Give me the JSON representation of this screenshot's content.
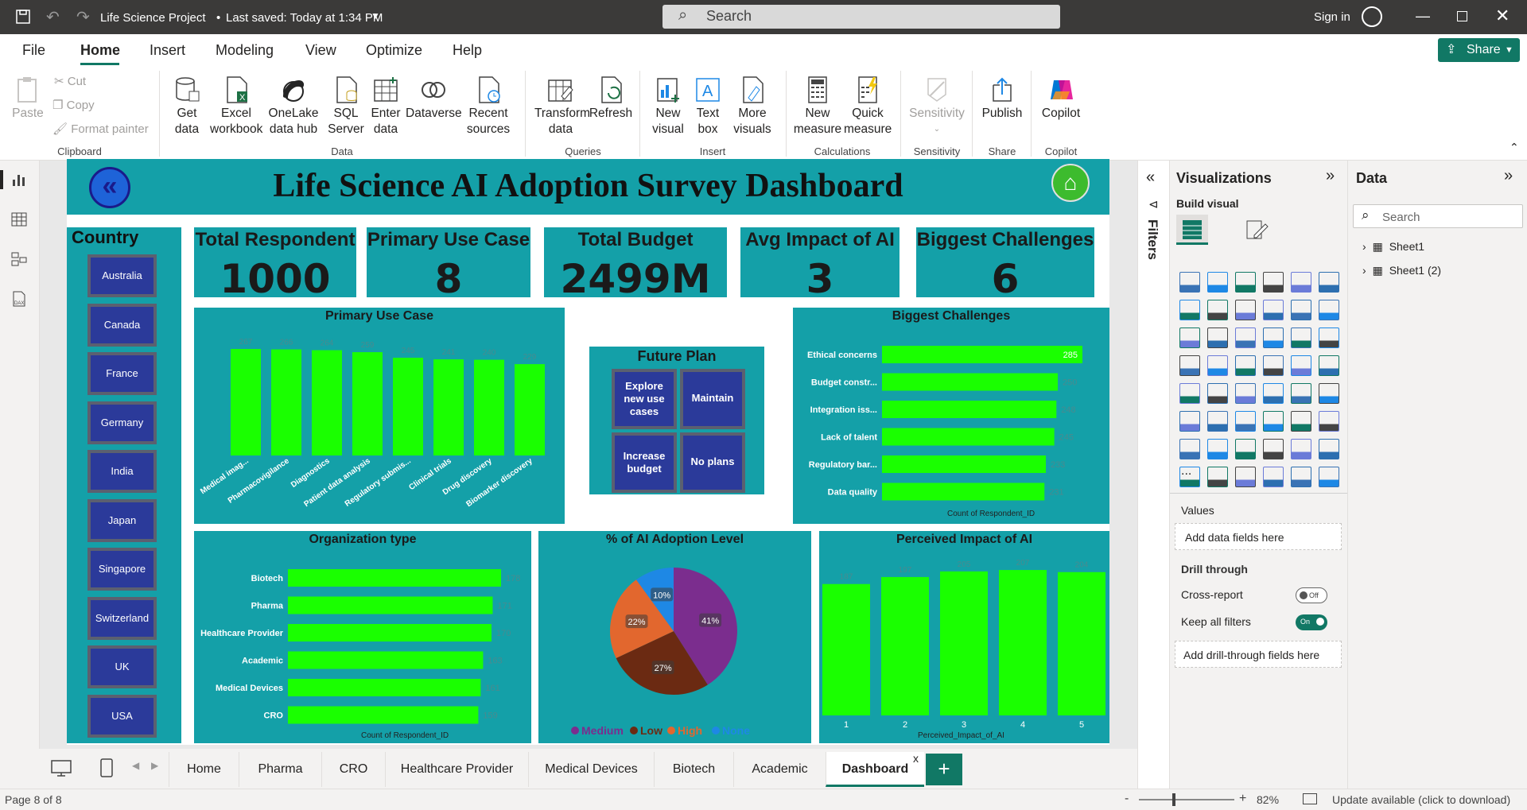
{
  "app": {
    "title": "Life Science Project",
    "saved": "Last saved: Today at 1:34 PM",
    "search": "Search",
    "signin": "Sign in"
  },
  "menu": {
    "file": "File",
    "home": "Home",
    "insert": "Insert",
    "modeling": "Modeling",
    "view": "View",
    "optimize": "Optimize",
    "help": "Help",
    "share": "Share"
  },
  "ribbon": {
    "paste": "Paste",
    "cut": "Cut",
    "copy": "Copy",
    "format_painter": "Format painter",
    "clipboard": "Clipboard",
    "get_data": "Get data",
    "excel": "Excel workbook",
    "onelake": "OneLake data hub",
    "sql": "SQL Server",
    "enter": "Enter data",
    "dataverse": "Dataverse",
    "recent": "Recent sources",
    "data": "Data",
    "transform": "Transform data",
    "refresh": "Refresh",
    "queries": "Queries",
    "new_visual": "New visual",
    "text_box": "Text box",
    "more_visuals": "More visuals",
    "insert": "Insert",
    "new_measure": "New measure",
    "quick_measure": "Quick measure",
    "calculations": "Calculations",
    "sensitivity": "Sensitivity",
    "sensitivity_group": "Sensitivity",
    "publish": "Publish",
    "share_group": "Share",
    "copilot": "Copilot",
    "copilot_group": "Copilot"
  },
  "dashboard": {
    "title": "Life Science AI Adoption Survey Dashboard",
    "country_label": "Country",
    "countries": [
      "Australia",
      "Canada",
      "France",
      "Germany",
      "India",
      "Japan",
      "Singapore",
      "Switzerland",
      "UK",
      "USA"
    ],
    "kpis": [
      {
        "label": "Total Respondent",
        "value": "1000"
      },
      {
        "label": "Primary Use Case",
        "value": "8"
      },
      {
        "label": "Total Budget",
        "value": "2499M"
      },
      {
        "label": "Avg Impact of AI",
        "value": "3"
      },
      {
        "label": "Biggest Challenges",
        "value": "6"
      }
    ],
    "future_plan": {
      "title": "Future Plan",
      "options": [
        "Explore new use cases",
        "Maintain",
        "Increase budget",
        "No plans"
      ]
    }
  },
  "chart_data": [
    {
      "type": "bar",
      "title": "Primary Use Case",
      "categories": [
        "Medical imag...",
        "Pharmacovigilance",
        "Diagnostics",
        "Patient data analysis",
        "Regulatory submis...",
        "Clinical trials",
        "Drug discovery",
        "Biomarker discovery"
      ],
      "values": [
        267,
        266,
        264,
        259,
        245,
        241,
        240,
        229
      ]
    },
    {
      "type": "bar",
      "orientation": "horizontal",
      "title": "Biggest Challenges",
      "categories": [
        "Ethical concerns",
        "Budget constr...",
        "Integration iss...",
        "Lack of talent",
        "Regulatory bar...",
        "Data quality"
      ],
      "values": [
        285,
        250,
        248,
        245,
        233,
        231
      ],
      "xlabel": "Count of Respondent_ID"
    },
    {
      "type": "bar",
      "orientation": "horizontal",
      "title": "Organization type",
      "categories": [
        "Biotech",
        "Pharma",
        "Healthcare Provider",
        "Academic",
        "Medical Devices",
        "CRO"
      ],
      "values": [
        178,
        171,
        170,
        163,
        161,
        159
      ],
      "xlabel": "Count of Respondent_ID"
    },
    {
      "type": "pie",
      "title": "% of AI Adoption Level",
      "categories": [
        "Medium",
        "Low",
        "High",
        "None"
      ],
      "values": [
        41,
        27,
        22,
        10
      ],
      "labels": [
        "41%",
        "27%",
        "22%",
        "10%"
      ],
      "colors": [
        "#7b2d8e",
        "#6b2a12",
        "#e2672e",
        "#1e88e5"
      ]
    },
    {
      "type": "bar",
      "title": "Perceived Impact of AI",
      "categories": [
        "1",
        "2",
        "3",
        "4",
        "5"
      ],
      "values": [
        187,
        197,
        205,
        207,
        204
      ],
      "xlabel": "Perceived_Impact_of_AI"
    }
  ],
  "visualizations": {
    "title": "Visualizations",
    "build": "Build visual",
    "values": "Values",
    "add_fields": "Add data fields here",
    "drill": "Drill through",
    "cross": "Cross-report",
    "cross_state": "Off",
    "keep": "Keep all filters",
    "keep_state": "On",
    "add_drill": "Add drill-through fields here",
    "more": "..."
  },
  "filters": {
    "label": "Filters"
  },
  "data_pane": {
    "title": "Data",
    "search": "Search",
    "tables": [
      "Sheet1",
      "Sheet1 (2)"
    ]
  },
  "tabs": [
    "Home",
    "Pharma",
    "CRO",
    "Healthcare Provider",
    "Medical Devices",
    "Biotech",
    "Academic",
    "Dashboard"
  ],
  "status": {
    "page": "Page 8 of 8",
    "zoom": "82%",
    "update": "Update available (click to download)",
    "zoom_minus": "-",
    "zoom_plus": "+"
  },
  "colors": {
    "teal": "#14a0a8",
    "bar": "#1aff00",
    "navy": "#2b3a9a"
  }
}
